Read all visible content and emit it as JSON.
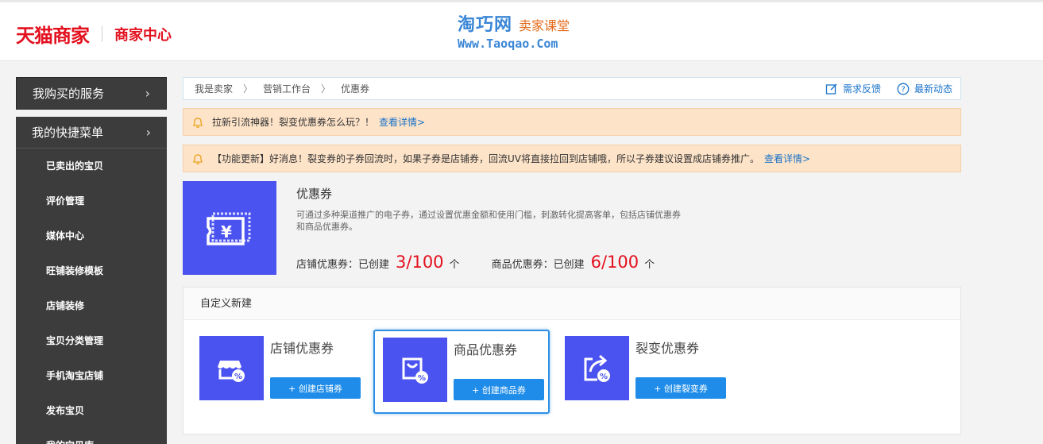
{
  "header": {
    "brand_logo": "天猫商家",
    "brand_sub": "商家中心",
    "watermark_name": "淘巧网",
    "watermark_tag": "卖家课堂",
    "watermark_url": "Www.Taoqao.Com"
  },
  "sidebar": {
    "bought_services": "我购买的服务",
    "quick_menu": "我的快捷菜单",
    "items": [
      {
        "label": "已卖出的宝贝"
      },
      {
        "label": "评价管理"
      },
      {
        "label": "媒体中心"
      },
      {
        "label": "旺铺装修模板"
      },
      {
        "label": "店铺装修"
      },
      {
        "label": "宝贝分类管理"
      },
      {
        "label": "手机淘宝店铺"
      },
      {
        "label": "发布宝贝"
      },
      {
        "label": "我的宝贝库"
      }
    ]
  },
  "breadcrumb": {
    "items": [
      "我是卖家",
      "营销工作台",
      "优惠券"
    ],
    "feedback": "需求反馈",
    "news": "最新动态"
  },
  "notices": [
    {
      "text": "拉新引流神器！裂变优惠券怎么玩？！",
      "link": "查看详情>"
    },
    {
      "text": "【功能更新】好消息！裂变券的子券回流时，如果子券是店铺券，回流UV将直接拉回到店铺哦，所以子券建议设置成店铺券推广。",
      "link": "查看详情>"
    }
  ],
  "coupon": {
    "title": "优惠券",
    "description": "可通过多种渠道推广的电子券，通过设置优惠金额和使用门槛，刺激转化提高客单，包括店铺优惠券和商品优惠券。",
    "shop_label": "店铺优惠券：已创建",
    "shop_count": "3/100",
    "unit": "个",
    "item_label": "商品优惠券：已创建",
    "item_count": "6/100"
  },
  "custom": {
    "title": "自定义新建",
    "cards": [
      {
        "title": "店铺优惠券",
        "button": "+ 创建店铺券",
        "icon": "shop-coupon-icon"
      },
      {
        "title": "商品优惠券",
        "button": "+ 创建商品券",
        "icon": "bag-coupon-icon"
      },
      {
        "title": "裂变优惠券",
        "button": "+ 创建裂变券",
        "icon": "share-coupon-icon"
      }
    ]
  },
  "colors": {
    "brand_red": "#e3101e",
    "accent_blue": "#1e8ce8",
    "icon_bg": "#4a52f0",
    "notice_bg": "#fde3c8"
  }
}
